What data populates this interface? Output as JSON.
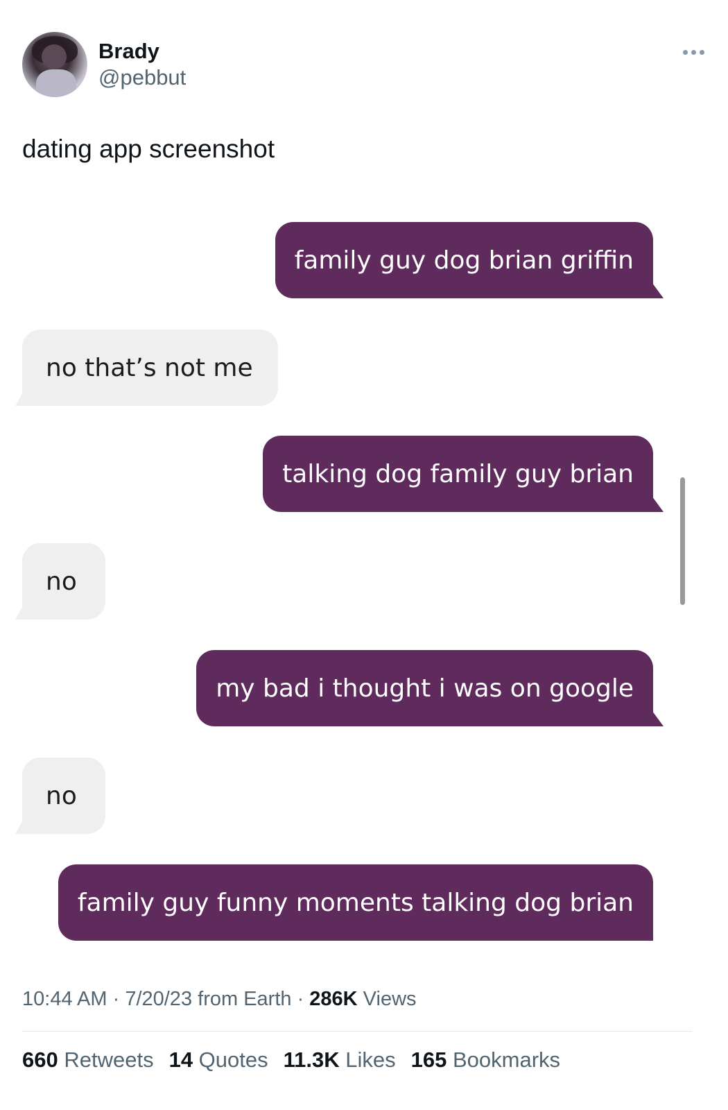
{
  "author": {
    "display_name": "Brady",
    "handle": "@pebbut",
    "avatar_icon": "profile-photo"
  },
  "more_icon": "more-options-icon",
  "tweet": {
    "text": "dating app screenshot"
  },
  "messages": [
    {
      "side": "sent",
      "text": "family guy dog brian griffin"
    },
    {
      "side": "received",
      "text": "no that’s not me"
    },
    {
      "side": "sent",
      "text": "talking dog family guy brian"
    },
    {
      "side": "received",
      "text": "no"
    },
    {
      "side": "sent",
      "text": "my bad i thought i was on google"
    },
    {
      "side": "received",
      "text": "no"
    },
    {
      "side": "sent",
      "text": "family guy funny moments talking dog brian"
    }
  ],
  "colors": {
    "sent_bubble": "#5e2b5c",
    "received_bubble": "#efefef",
    "secondary_text": "#536471"
  },
  "meta": {
    "time": "10:44 AM",
    "sep1": " · ",
    "date": "7/20/23",
    "source": " from Earth",
    "sep2": " · ",
    "views_count": "286K",
    "views_label": " Views"
  },
  "stats": {
    "retweets_count": "660",
    "retweets_label": " Retweets",
    "quotes_count": "14",
    "quotes_label": " Quotes",
    "likes_count": "11.3K",
    "likes_label": " Likes",
    "bookmarks_count": "165",
    "bookmarks_label": " Bookmarks"
  }
}
